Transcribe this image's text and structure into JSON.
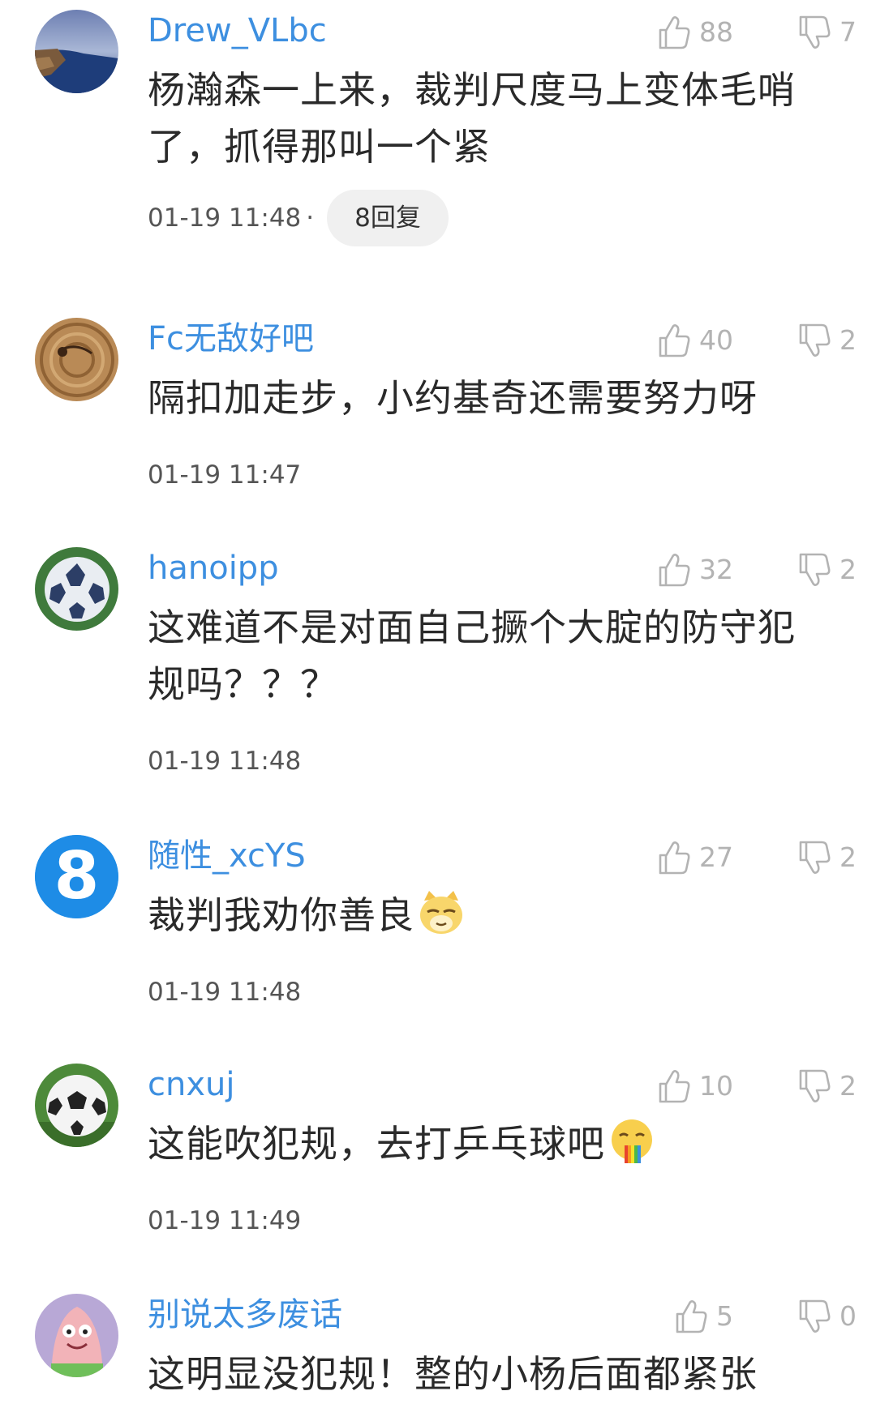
{
  "comments": [
    {
      "username": "Drew_VLbc",
      "likes": "88",
      "dislikes": "7",
      "text": "杨瀚森一上来，裁判尺度马上变体毛哨了，抓得那叫一个紧",
      "timestamp": "01-19 11:48",
      "separator": "·",
      "reply_label": "8回复"
    },
    {
      "username": "Fc无敌好吧",
      "likes": "40",
      "dislikes": "2",
      "text": "隔扣加走步，小约基奇还需要努力呀",
      "timestamp": "01-19 11:47"
    },
    {
      "username": "hanoipp",
      "likes": "32",
      "dislikes": "2",
      "text": "这难道不是对面自己撅个大腚的防守犯规吗？？？",
      "timestamp": "01-19 11:48"
    },
    {
      "username": "随性_xcYS",
      "likes": "27",
      "dislikes": "2",
      "text": "裁判我劝你善良",
      "emoji": "smug-cat-emoji",
      "timestamp": "01-19 11:48",
      "avatar_text": "8"
    },
    {
      "username": "cnxuj",
      "likes": "10",
      "dislikes": "2",
      "text": "这能吹犯规，去打乒乓球吧",
      "emoji": "rainbow-vomit-emoji",
      "timestamp": "01-19 11:49"
    },
    {
      "username": "别说太多废话",
      "likes": "5",
      "dislikes": "0",
      "text": "这明显没犯规！整的小杨后面都紧张"
    }
  ],
  "colors": {
    "username": "#3d8fe0",
    "text": "#2a2a2a",
    "count": "#b3b3b3",
    "meta": "#555555",
    "reply_bg": "#f0f0f0"
  }
}
